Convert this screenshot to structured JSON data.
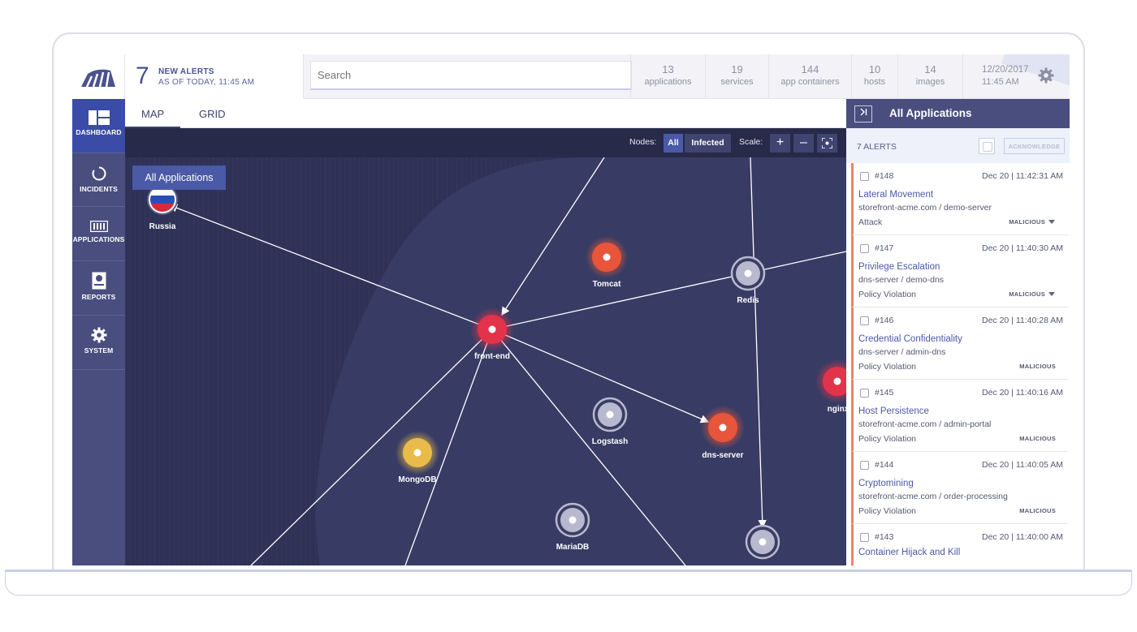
{
  "header": {
    "alerts_count": "7",
    "alerts_title": "NEW ALERTS",
    "alerts_sub": "AS OF TODAY, 11:45 AM",
    "search_placeholder": "Search",
    "stats": [
      {
        "num": "13",
        "label": "applications"
      },
      {
        "num": "19",
        "label": "services"
      },
      {
        "num": "144",
        "label": "app containers"
      },
      {
        "num": "10",
        "label": "hosts"
      },
      {
        "num": "14",
        "label": "images"
      }
    ],
    "date": "12/20/2017",
    "time": "11:45 AM"
  },
  "sidebar": {
    "items": [
      {
        "label": "DASHBOARD",
        "icon": "dashboard-icon"
      },
      {
        "label": "INCIDENTS",
        "icon": "incidents-icon"
      },
      {
        "label": "APPLICATIONS",
        "icon": "applications-icon"
      },
      {
        "label": "REPORTS",
        "icon": "reports-icon"
      },
      {
        "label": "SYSTEM",
        "icon": "gear-icon"
      }
    ]
  },
  "tabs": [
    {
      "label": "MAP"
    },
    {
      "label": "GRID"
    }
  ],
  "map": {
    "toolbar": {
      "nodes_label": "Nodes:",
      "all_label": "All",
      "infected_label": "Infected",
      "scale_label": "Scale:",
      "zoom_in": "+",
      "zoom_out": "–"
    },
    "all_apps_chip": "All Applications",
    "nodes": [
      {
        "id": "russia",
        "label": "Russia",
        "kind": "flag"
      },
      {
        "id": "tomcat",
        "label": "Tomcat",
        "kind": "orange"
      },
      {
        "id": "redis",
        "label": "Redis",
        "kind": "grey"
      },
      {
        "id": "frontend",
        "label": "front-end",
        "kind": "red"
      },
      {
        "id": "nginx",
        "label": "nginx",
        "kind": "red"
      },
      {
        "id": "mongodb",
        "label": "MongoDB",
        "kind": "yellow"
      },
      {
        "id": "logstash",
        "label": "Logstash",
        "kind": "grey"
      },
      {
        "id": "dnsserver",
        "label": "dns-server",
        "kind": "orange"
      },
      {
        "id": "mariadb",
        "label": "MariaDB",
        "kind": "grey"
      },
      {
        "id": "bottom",
        "label": "",
        "kind": "grey"
      }
    ],
    "colors": {
      "red": "#e2334b",
      "orange": "#e8553a",
      "yellow": "#e9bb4a",
      "grey": "#b8b9ce"
    }
  },
  "panel": {
    "title": "All Applications",
    "alerts_count": "7 ALERTS",
    "acknowledge": "ACKNOWLEDGE",
    "alerts": [
      {
        "id": "#148",
        "time": "Dec 20 | 11:42:31 AM",
        "name": "Lateral Movement",
        "path": "storefront-acme.com / demo-server",
        "category": "Attack",
        "severity": "MALICIOUS",
        "expandable": true
      },
      {
        "id": "#147",
        "time": "Dec 20 | 11:40:30 AM",
        "name": "Privilege Escalation",
        "path": "dns-server / demo-dns",
        "category": "Policy Violation",
        "severity": "MALICIOUS",
        "expandable": true
      },
      {
        "id": "#146",
        "time": "Dec 20 | 11:40:28 AM",
        "name": "Credential Confidentiality",
        "path": "dns-server / admin-dns",
        "category": "Policy Violation",
        "severity": "MALICIOUS",
        "expandable": false
      },
      {
        "id": "#145",
        "time": "Dec 20 | 11:40:16 AM",
        "name": "Host Persistence",
        "path": "storefront-acme.com / admin-portal",
        "category": "Policy Violation",
        "severity": "MALICIOUS",
        "expandable": false
      },
      {
        "id": "#144",
        "time": "Dec 20 | 11:40:05 AM",
        "name": "Cryptomining",
        "path": "storefront-acme.com / order-processing",
        "category": "Policy Violation",
        "severity": "MALICIOUS",
        "expandable": false
      },
      {
        "id": "#143",
        "time": "Dec 20 | 11:40:00 AM",
        "name": "Container Hijack and Kill",
        "path": "",
        "category": "",
        "severity": "",
        "expandable": false
      }
    ]
  }
}
